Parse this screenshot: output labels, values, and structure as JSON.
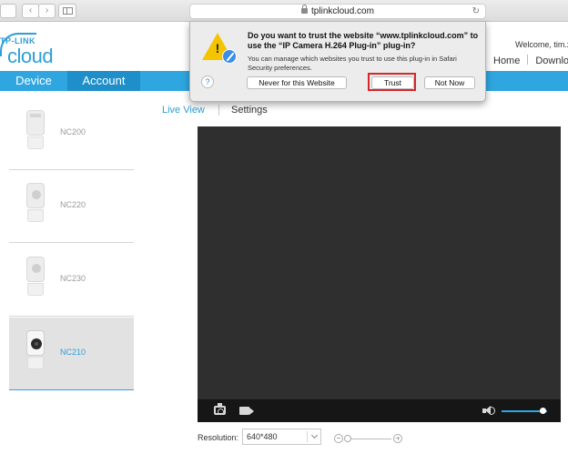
{
  "browser": {
    "url": "tplinkcloud.com"
  },
  "header": {
    "logo_brand": "TP-LINK",
    "logo_product": "cloud",
    "welcome": "Welcome, tim.xi",
    "nav": [
      "Home",
      "Download"
    ]
  },
  "tabs": {
    "device": "Device",
    "account": "Account"
  },
  "subtabs": {
    "live_view": "Live View",
    "settings": "Settings"
  },
  "devices": [
    {
      "name": "NC200",
      "selected": false
    },
    {
      "name": "NC220",
      "selected": false
    },
    {
      "name": "NC230",
      "selected": false
    },
    {
      "name": "NC210",
      "selected": true
    }
  ],
  "player": {
    "resolution_label": "Resolution:",
    "resolution_value": "640*480",
    "volume_level": 0.9,
    "zoom_level": 0.0
  },
  "dialog": {
    "title": "Do you want to trust the website “www.tplinkcloud.com” to use the “IP Camera H.264 Plug-in” plug-in?",
    "message": "You can manage which websites you trust to use this plug-in in Safari Security preferences.",
    "help": "?",
    "never": "Never for this Website",
    "trust": "Trust",
    "not_now": "Not Now"
  },
  "colors": {
    "accent": "#2fa6e0",
    "highlight": "#d8262a",
    "video_bg": "#2f2f2f"
  }
}
